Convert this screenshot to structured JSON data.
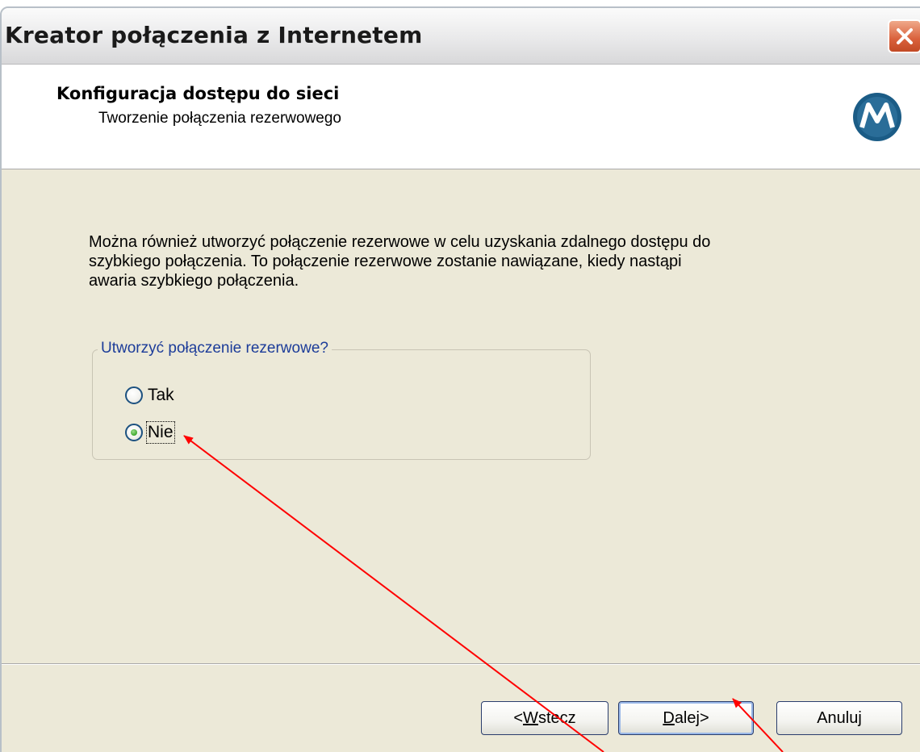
{
  "window": {
    "title": "Kreator połączenia z Internetem"
  },
  "header": {
    "title": "Konfiguracja dostępu do sieci",
    "subtitle": "Tworzenie połączenia rezerwowego",
    "logo_icon": "motorola-logo-icon"
  },
  "description": {
    "lines": [
      "Można również utworzyć połączenie rezerwowe w celu uzyskania zdalnego dostępu do",
      "szybkiego połączenia. To połączenie rezerwowe zostanie nawiązane, kiedy nastąpi",
      "awaria szybkiego połączenia."
    ]
  },
  "backup_group": {
    "legend": "Utworzyć połączenie rezerwowe?",
    "options": [
      {
        "label": "Tak",
        "checked": false
      },
      {
        "label": "Nie",
        "checked": true
      }
    ]
  },
  "buttons": {
    "back": {
      "prefix": "< ",
      "mnemonic": "W",
      "rest": "stecz"
    },
    "next": {
      "mnemonic": "D",
      "rest": "alej",
      "suffix": " >"
    },
    "cancel": "Anuluj"
  },
  "colors": {
    "window_bg": "#ece9d8",
    "legend_text": "#1c3c99",
    "annotation_arrow": "#ff0000",
    "logo": "#1b5c86"
  }
}
